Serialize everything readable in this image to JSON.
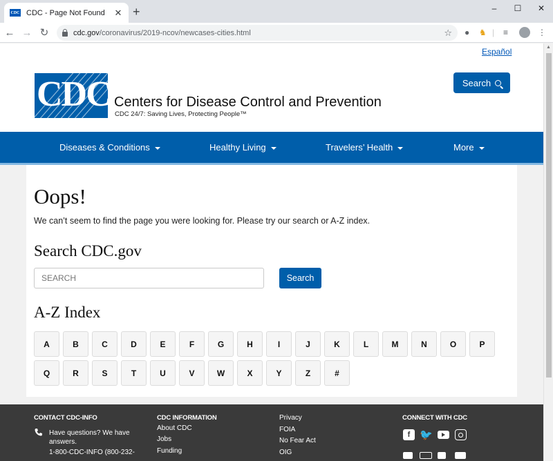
{
  "browser": {
    "tab_title": "CDC - Page Not Found",
    "favicon_text": "CDC",
    "tab_close": "✕",
    "new_tab": "+",
    "url_domain": "cdc.gov",
    "url_path": "/coronavirus/2019-ncov/newcases-cities.html",
    "window_min": "–",
    "window_max": "☐",
    "window_close": "✕"
  },
  "header": {
    "language_link": "Español",
    "logo_text": "CDC",
    "org_name": "Centers for Disease Control and Prevention",
    "tagline": "CDC 24/7: Saving Lives, Protecting People™",
    "search_label": "Search"
  },
  "nav": {
    "items": [
      {
        "label": "Diseases & Conditions"
      },
      {
        "label": "Healthy Living"
      },
      {
        "label": "Travelers’ Health"
      },
      {
        "label": "More"
      }
    ]
  },
  "main": {
    "heading": "Oops!",
    "message": "We can’t seem to find the page you were looking for. Please try our search or A-Z index.",
    "search_heading": "Search CDC.gov",
    "search_placeholder": "SEARCH",
    "search_button": "Search",
    "az_heading": "A-Z Index",
    "az_letters": [
      "A",
      "B",
      "C",
      "D",
      "E",
      "F",
      "G",
      "H",
      "I",
      "J",
      "K",
      "L",
      "M",
      "N",
      "O",
      "P",
      "Q",
      "R",
      "S",
      "T",
      "U",
      "V",
      "W",
      "X",
      "Y",
      "Z",
      "#"
    ]
  },
  "footer": {
    "contact_heading": "CONTACT CDC-INFO",
    "contact_line1": "Have questions? We have",
    "contact_line2": "answers.",
    "contact_line3": "1-800-CDC-INFO (800-232-",
    "info_heading": "CDC INFORMATION",
    "info_links": [
      "About CDC",
      "Jobs",
      "Funding"
    ],
    "policy_links": [
      "Privacy",
      "FOIA",
      "No Fear Act",
      "OIG"
    ],
    "connect_heading": "CONNECT WITH CDC"
  },
  "colors": {
    "brand_blue": "#005eaa",
    "footer_bg": "#3a3a3a"
  }
}
